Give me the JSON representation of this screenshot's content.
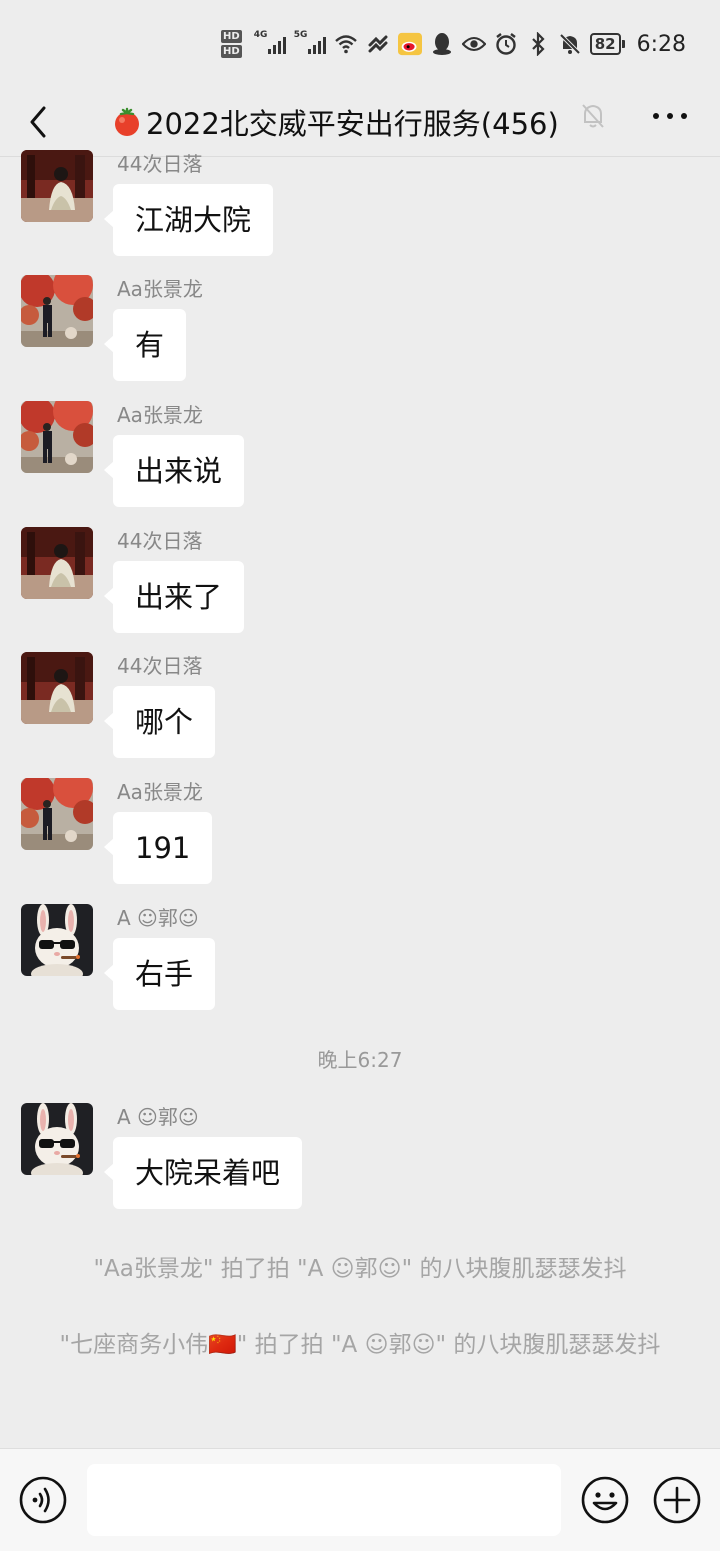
{
  "status_bar": {
    "hd1": "HD",
    "hd2": "HD",
    "net1": "4G",
    "net2": "5G",
    "battery": "82",
    "time": "6:28",
    "icons": [
      "wifi-icon",
      "weibo-icon",
      "qq-icon",
      "eye-icon",
      "alarm-icon",
      "bluetooth-icon",
      "mute-icon"
    ]
  },
  "chat": {
    "title": "2022北交威平安出行服务(456)",
    "title_emoji": "tomato",
    "muted": true
  },
  "messages": [
    {
      "sender": "44次日落",
      "text": "江湖大院",
      "avatar": "avatar-woman"
    },
    {
      "sender": "Aa张景龙",
      "text": "有",
      "avatar": "avatar-man-autumn"
    },
    {
      "sender": "Aa张景龙",
      "text": "出来说",
      "avatar": "avatar-man-autumn"
    },
    {
      "sender": "44次日落",
      "text": "出来了",
      "avatar": "avatar-woman"
    },
    {
      "sender": "44次日落",
      "text": "哪个",
      "avatar": "avatar-woman"
    },
    {
      "sender": "Aa张景龙",
      "text": "191",
      "avatar": "avatar-man-autumn"
    },
    {
      "sender": "A ☺郭☺",
      "text": "右手",
      "avatar": "avatar-rabbit-sunglasses"
    },
    {
      "sender": "A ☺郭☺",
      "text": "大院呆着吧",
      "avatar": "avatar-rabbit-sunglasses"
    }
  ],
  "timestamp": "晚上6:27",
  "system_notices": [
    "\"Aa张景龙\" 拍了拍 \"A ☺郭☺\" 的八块腹肌瑟瑟发抖",
    "\"七座商务小伟🇨🇳\" 拍了拍 \"A ☺郭☺\" 的八块腹肌瑟瑟发抖"
  ],
  "input": {
    "value": "",
    "icons": [
      "voice-icon",
      "emoji-icon",
      "plus-icon"
    ]
  }
}
